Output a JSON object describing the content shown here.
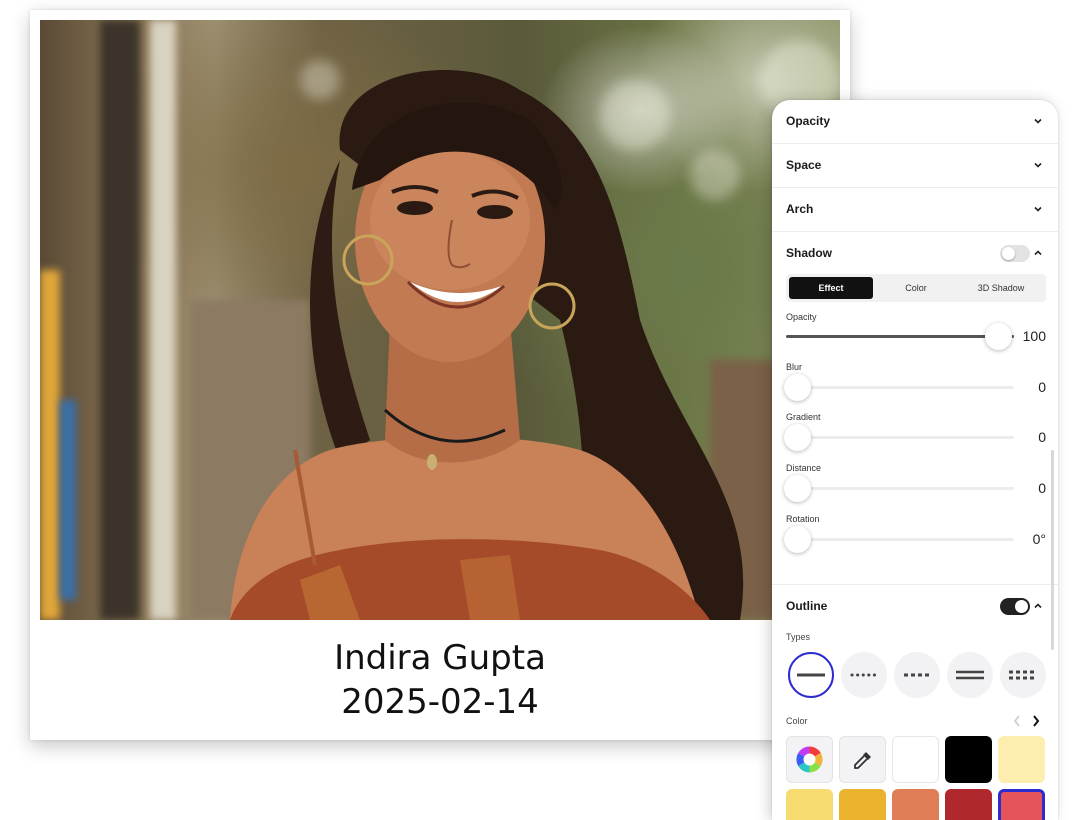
{
  "card": {
    "name": "Indira Gupta",
    "date": "2025-02-14"
  },
  "panel": {
    "sections": [
      {
        "label": "Opacity",
        "expanded": false
      },
      {
        "label": "Space",
        "expanded": false
      },
      {
        "label": "Arch",
        "expanded": false
      }
    ],
    "shadow": {
      "label": "Shadow",
      "enabled": false,
      "expanded": true,
      "tabs": [
        {
          "label": "Effect",
          "active": true
        },
        {
          "label": "Color",
          "active": false
        },
        {
          "label": "3D Shadow",
          "active": false
        }
      ],
      "sliders": [
        {
          "label": "Opacity",
          "value": "100",
          "fraction": 1.0
        },
        {
          "label": "Blur",
          "value": "0",
          "fraction": 0
        },
        {
          "label": "Gradient",
          "value": "0",
          "fraction": 0
        },
        {
          "label": "Distance",
          "value": "0",
          "fraction": 0
        },
        {
          "label": "Rotation",
          "value": "0°",
          "fraction": 0
        }
      ]
    },
    "outline": {
      "label": "Outline",
      "enabled": true,
      "expanded": true,
      "types_label": "Types",
      "types": [
        "solid-line",
        "dotted-line",
        "dashed-line",
        "double-line",
        "double-dotted-line"
      ],
      "selected_type": "solid-line",
      "color_label": "Color",
      "color_tools": [
        "color-wheel-icon",
        "eyedropper-icon"
      ],
      "swatches": [
        "#ffffff",
        "#000000",
        "#fdeeb0",
        "#f6db70",
        "#eab32e",
        "#df7d57",
        "#b0272d",
        "#e4545a"
      ],
      "selected_swatch": "#e4545a"
    }
  }
}
